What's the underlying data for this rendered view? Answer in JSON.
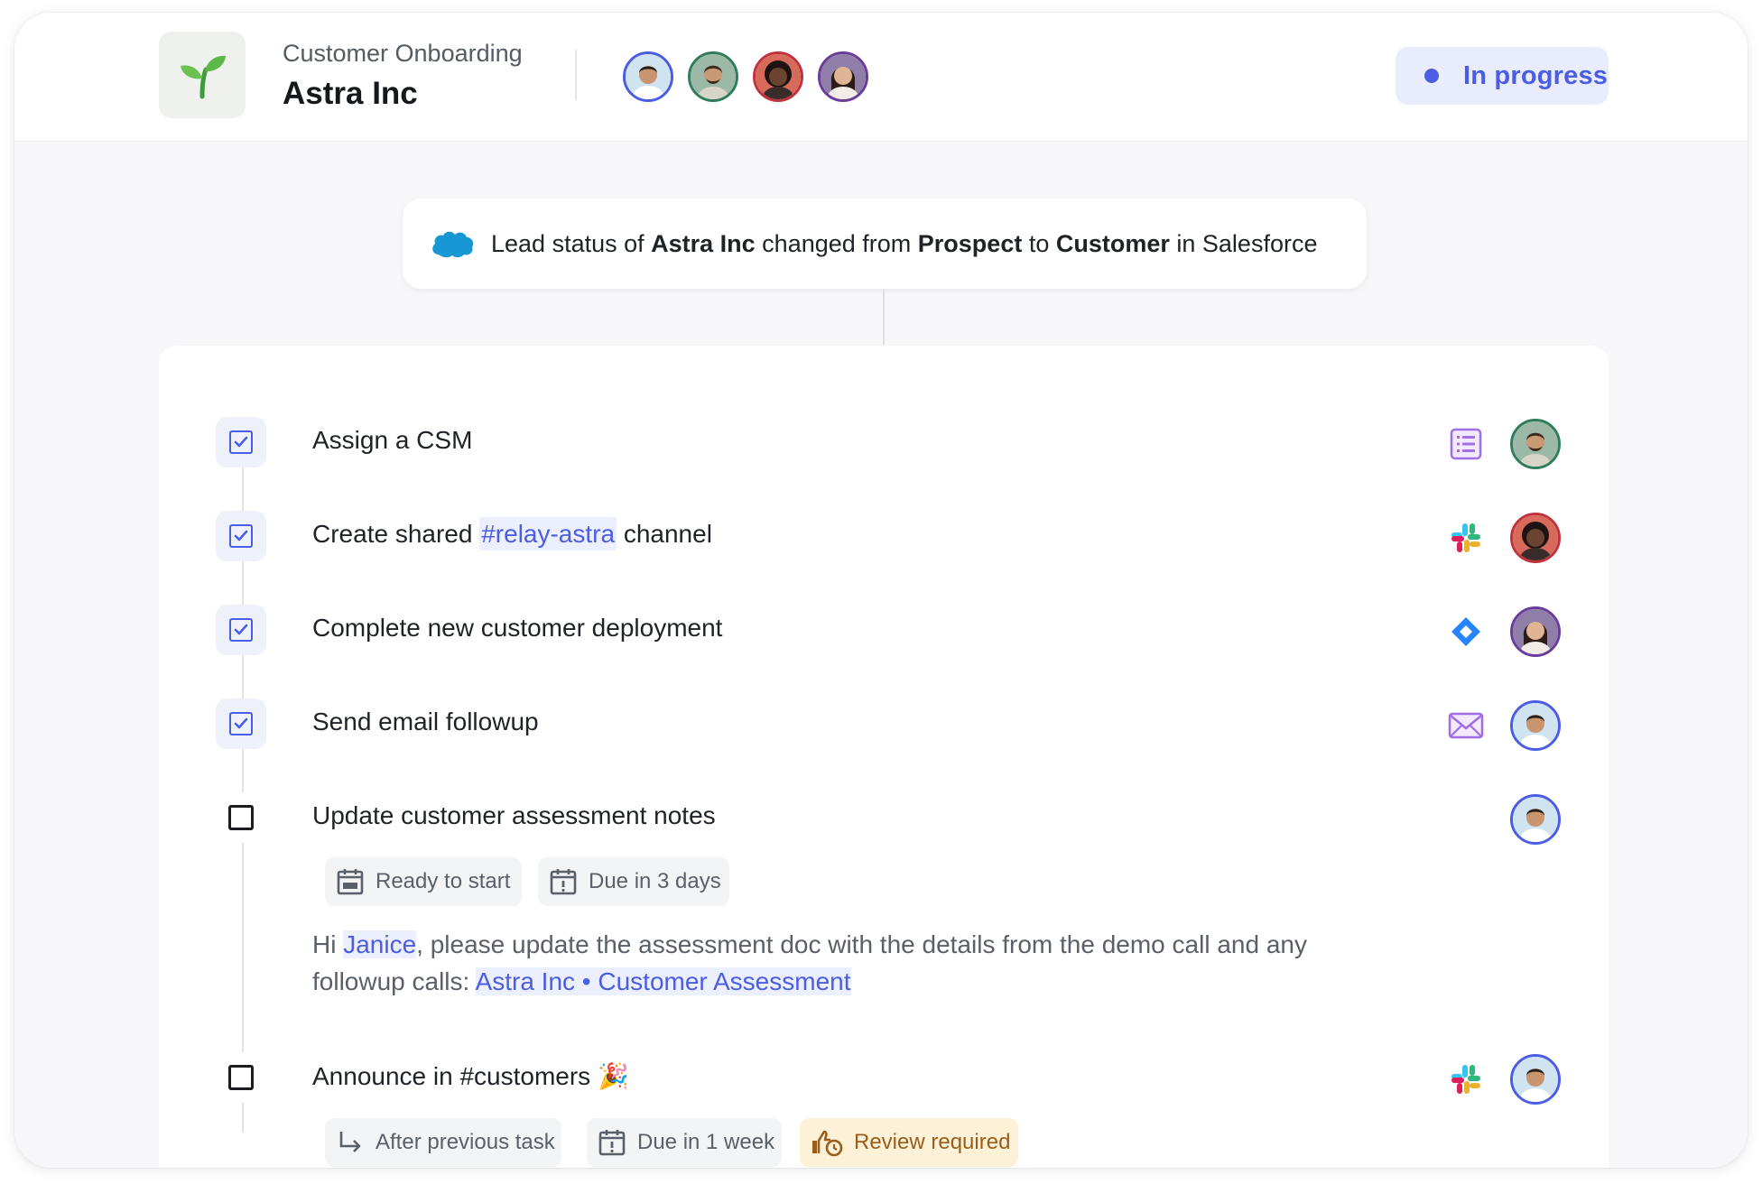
{
  "header": {
    "process_name": "Customer Onboarding",
    "company": "Astra Inc",
    "logo_icon": "seedling-icon",
    "participants": [
      {
        "name": "participant-1",
        "ring": "#4b5de4",
        "bg": "#cfe3f0",
        "skin": "#c8956f",
        "hair": "#2a1e18"
      },
      {
        "name": "participant-2",
        "ring": "#2f7d5b",
        "bg": "#9cb8a6",
        "skin": "#c79a74",
        "hair": "#3a2a20"
      },
      {
        "name": "participant-3",
        "ring": "#c0323c",
        "bg": "#d86a5c",
        "skin": "#6b4331",
        "hair": "#1d1411"
      },
      {
        "name": "participant-4",
        "ring": "#6a3d9a",
        "bg": "#8f7fa8",
        "skin": "#e0b596",
        "hair": "#2b1c16"
      }
    ],
    "status": {
      "label": "In progress",
      "color": "#4b5de4"
    }
  },
  "trigger": {
    "icon": "salesforce-cloud-icon",
    "parts": {
      "p1": "Lead status of ",
      "company": "Astra Inc",
      "p2": " changed from ",
      "from": "Prospect",
      "p3": " to ",
      "to": "Customer",
      "p4": " in Salesforce"
    }
  },
  "tasks": [
    {
      "title": "Assign a CSM",
      "checked": true,
      "app_icon": "form-list-icon"
    },
    {
      "title_pre": "Create shared ",
      "title_tag": "#relay-astra",
      "title_post": " channel",
      "checked": true,
      "app_icon": "slack-icon"
    },
    {
      "title": "Complete new customer deployment",
      "checked": true,
      "app_icon": "jira-icon"
    },
    {
      "title": "Send email followup",
      "checked": true,
      "app_icon": "mail-icon"
    },
    {
      "title": "Update customer assessment notes",
      "checked": false,
      "chips": [
        {
          "icon": "calendar-icon",
          "label": "Ready to start"
        },
        {
          "icon": "calendar-alert-icon",
          "label": "Due in 3 days"
        }
      ],
      "note": {
        "pre": "Hi ",
        "mention": "Janice",
        "mid": ", please update the assessment doc with the details from the demo call and any followup calls: ",
        "link": "Astra Inc • Customer Assessment"
      }
    },
    {
      "title": "Announce in #customers",
      "emoji": "🎉",
      "checked": false,
      "app_icon": "slack-icon",
      "chips": [
        {
          "icon": "arrow-turn-icon",
          "label": "After previous task"
        },
        {
          "icon": "calendar-alert-icon",
          "label": "Due in 1 week"
        },
        {
          "icon": "thumbs-up-clock-icon",
          "label": "Review required"
        }
      ]
    }
  ]
}
